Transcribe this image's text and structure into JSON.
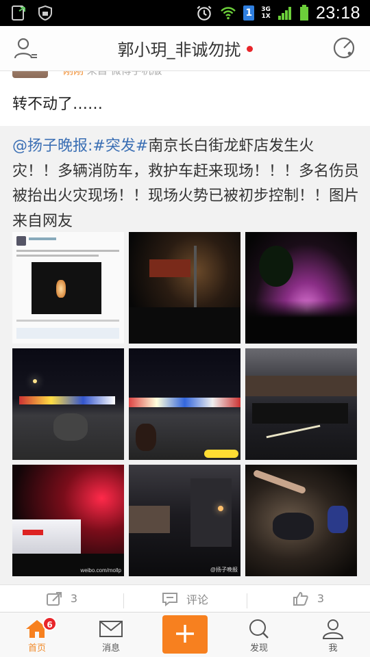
{
  "status_bar": {
    "time": "23:18",
    "net_badge": "1",
    "net_type_top": "3G",
    "net_type_bottom": "1X"
  },
  "header": {
    "title": "郭小玥_非诚勿扰"
  },
  "retweeter": {
    "name": "刚刚",
    "source": "来自 微博手机版"
  },
  "post": {
    "text": "转不动了……"
  },
  "original": {
    "mention": "@扬子晚报",
    "topic": ":#突发#",
    "body": "南京长白街龙虾店发生火灾！！多辆消防车，救护车赶来现场！！！多名伤员被抬出火灾现场！！现场火势已被初步控制！！图片来自网友",
    "images": [
      "screenshot-thumb",
      "street-night-vehicles",
      "purple-fire-glow",
      "night-street-traffic",
      "night-street-traffic-2",
      "crowd-street",
      "ambulance-red-lights",
      "dark-street-crowd",
      "injured-person"
    ],
    "watermarks": [
      "@扬子晚报",
      "weibo.com/mollp"
    ]
  },
  "actions": {
    "repost_count": "3",
    "comment_label": "评论",
    "like_count": "3"
  },
  "tabbar": {
    "home": "首页",
    "home_badge": "6",
    "messages": "消息",
    "discover": "发现",
    "me": "我"
  },
  "colors": {
    "accent": "#f7801f",
    "link": "#3b6fb4",
    "badge": "#e8252a"
  }
}
